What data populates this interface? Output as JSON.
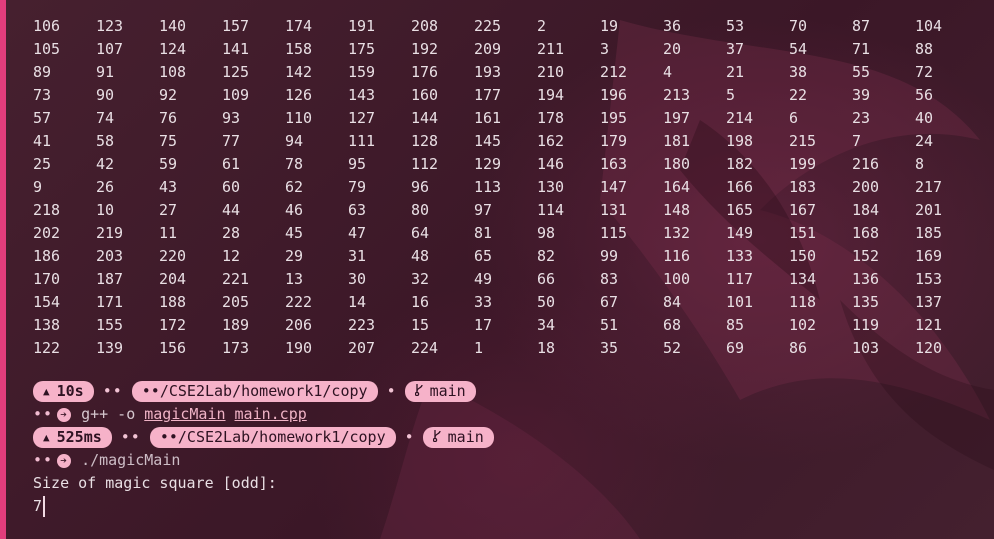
{
  "grid": [
    [
      "106",
      "123",
      "140",
      "157",
      "174",
      "191",
      "208",
      "225",
      "2",
      "19",
      "36",
      "53",
      "70",
      "87",
      "104"
    ],
    [
      "105",
      "107",
      "124",
      "141",
      "158",
      "175",
      "192",
      "209",
      "211",
      "3",
      "20",
      "37",
      "54",
      "71",
      "88"
    ],
    [
      "89",
      "91",
      "108",
      "125",
      "142",
      "159",
      "176",
      "193",
      "210",
      "212",
      "4",
      "21",
      "38",
      "55",
      "72"
    ],
    [
      "73",
      "90",
      "92",
      "109",
      "126",
      "143",
      "160",
      "177",
      "194",
      "196",
      "213",
      "5",
      "22",
      "39",
      "56"
    ],
    [
      "57",
      "74",
      "76",
      "93",
      "110",
      "127",
      "144",
      "161",
      "178",
      "195",
      "197",
      "214",
      "6",
      "23",
      "40"
    ],
    [
      "41",
      "58",
      "75",
      "77",
      "94",
      "111",
      "128",
      "145",
      "162",
      "179",
      "181",
      "198",
      "215",
      "7",
      "24"
    ],
    [
      "25",
      "42",
      "59",
      "61",
      "78",
      "95",
      "112",
      "129",
      "146",
      "163",
      "180",
      "182",
      "199",
      "216",
      "8"
    ],
    [
      "9",
      "26",
      "43",
      "60",
      "62",
      "79",
      "96",
      "113",
      "130",
      "147",
      "164",
      "166",
      "183",
      "200",
      "217"
    ],
    [
      "218",
      "10",
      "27",
      "44",
      "46",
      "63",
      "80",
      "97",
      "114",
      "131",
      "148",
      "165",
      "167",
      "184",
      "201"
    ],
    [
      "202",
      "219",
      "11",
      "28",
      "45",
      "47",
      "64",
      "81",
      "98",
      "115",
      "132",
      "149",
      "151",
      "168",
      "185"
    ],
    [
      "186",
      "203",
      "220",
      "12",
      "29",
      "31",
      "48",
      "65",
      "82",
      "99",
      "116",
      "133",
      "150",
      "152",
      "169"
    ],
    [
      "170",
      "187",
      "204",
      "221",
      "13",
      "30",
      "32",
      "49",
      "66",
      "83",
      "100",
      "117",
      "134",
      "136",
      "153"
    ],
    [
      "154",
      "171",
      "188",
      "205",
      "222",
      "14",
      "16",
      "33",
      "50",
      "67",
      "84",
      "101",
      "118",
      "135",
      "137"
    ],
    [
      "138",
      "155",
      "172",
      "189",
      "206",
      "223",
      "15",
      "17",
      "34",
      "51",
      "68",
      "85",
      "102",
      "119",
      "121"
    ],
    [
      "122",
      "139",
      "156",
      "173",
      "190",
      "207",
      "224",
      "1",
      "18",
      "35",
      "52",
      "69",
      "86",
      "103",
      "120"
    ]
  ],
  "prompt1": {
    "duration": "10s",
    "path": "••/CSE2Lab/homework1/copy",
    "branch": "main",
    "cmd_prefix": "g++ -o",
    "cmd_arg1": "magicMain",
    "cmd_arg2": "main.cpp"
  },
  "prompt2": {
    "duration": "525ms",
    "path": "••/CSE2Lab/homework1/copy",
    "branch": "main",
    "cmd": "./magicMain"
  },
  "output": {
    "question": "Size of magic square [odd]:",
    "input": "7"
  },
  "icons": {
    "duration": "triangle-up-icon",
    "branch": "git-branch-icon",
    "prompt": "arrow-right-circle-icon"
  },
  "colors": {
    "background": "#3f1a2b",
    "accent": "#e13d7c",
    "pill": "#f6b2c9",
    "text": "#e9dfe4"
  }
}
